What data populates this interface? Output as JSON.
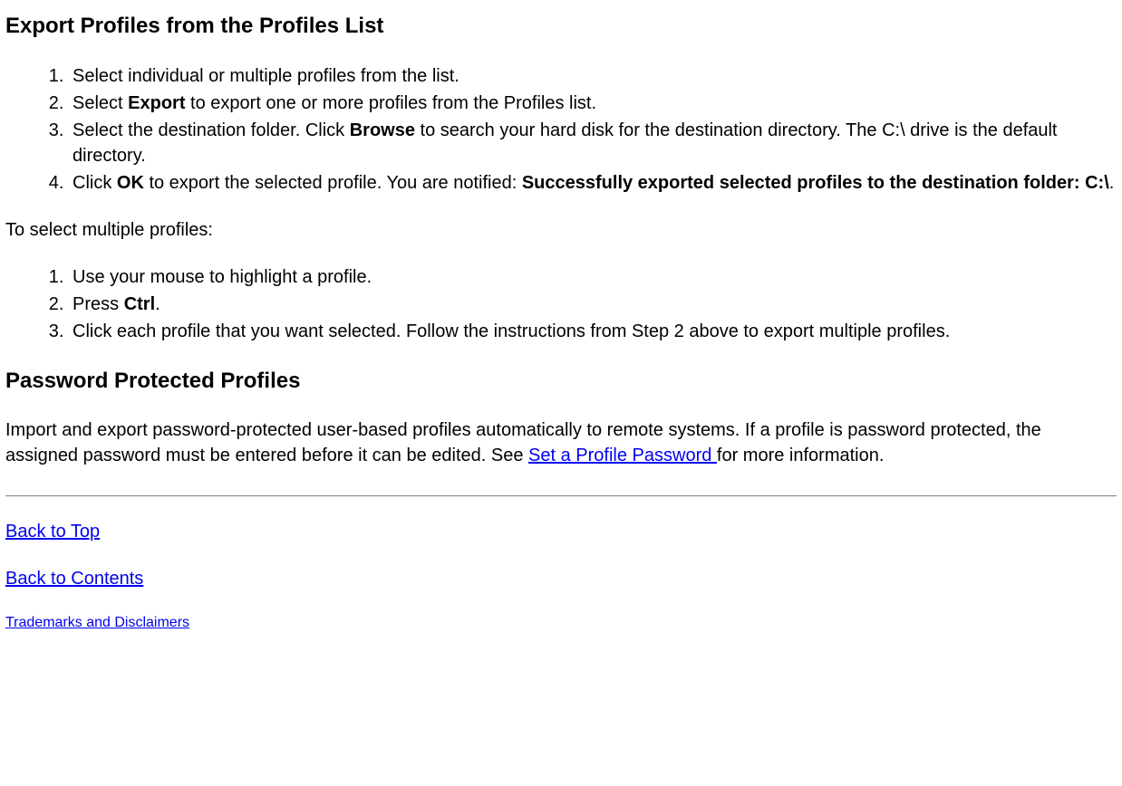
{
  "heading1": "Export Profiles from the Profiles List",
  "list1": {
    "item1": "Select individual or multiple profiles from the list.",
    "item2_a": "Select ",
    "item2_b": "Export",
    "item2_c": " to export one or more profiles from the Profiles list.",
    "item3_a": "Select the destination folder. Click ",
    "item3_b": "Browse",
    "item3_c": " to search your hard disk for the destination directory. The C:\\ drive is the default directory.",
    "item4_a": "Click ",
    "item4_b": "OK",
    "item4_c": " to export the selected profile. You are notified: ",
    "item4_d": "Successfully exported selected profiles to the destination folder: C:\\",
    "item4_e": "."
  },
  "para1": "To select multiple profiles:",
  "list2": {
    "item1": "Use your mouse to highlight a profile.",
    "item2_a": "Press ",
    "item2_b": "Ctrl",
    "item2_c": ".",
    "item3": "Click each profile that you want selected. Follow the instructions from Step 2 above to export multiple profiles."
  },
  "heading2": "Password Protected Profiles",
  "para2_a": "Import and export password-protected user-based profiles automatically to remote systems. If a profile is password protected, the assigned password must be entered before it can be edited. See ",
  "para2_link": "Set a Profile Password ",
  "para2_b": "for more information.",
  "links": {
    "back_top": "Back to Top",
    "back_contents": "Back to Contents",
    "trademarks": "Trademarks and Disclaimers"
  }
}
